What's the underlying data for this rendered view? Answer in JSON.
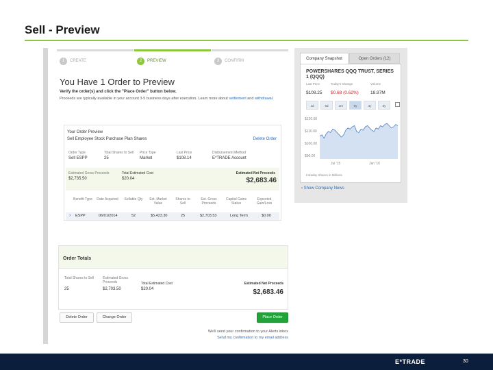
{
  "slide": {
    "title": "Sell - Preview",
    "page_number": "30",
    "logo_text": "E*TRADE",
    "logo_e": "E",
    "logo_star": "*",
    "logo_rest": "TRADE"
  },
  "stepper": [
    {
      "num": "1",
      "label": "CREATE",
      "active": false
    },
    {
      "num": "2",
      "label": "PREVIEW",
      "active": true
    },
    {
      "num": "3",
      "label": "CONFIRM",
      "active": false
    }
  ],
  "preview": {
    "heading": "You Have 1 Order to Preview",
    "verify": "Verify the order(s) and click the \"Place Order\" button below.",
    "proceeds_note": "Proceeds are typically available in your account 3-5 business days after execution. Learn more about",
    "link_settlement": "settlement",
    "and_text": "and",
    "link_withdrawal": "withdrawal."
  },
  "summary": {
    "title": "Your Order Preview",
    "subtitle": "Sell Employee Stock Purchase Plan Shares",
    "delete_link": "Delete Order",
    "fields": [
      {
        "label": "Order Type",
        "value": "Sell ESPP"
      },
      {
        "label": "Total Shares to Sell",
        "value": "25"
      },
      {
        "label": "Price Type",
        "value": "Market"
      },
      {
        "label": "Last Price",
        "value": "$108.14"
      },
      {
        "label": "Disbursement Method",
        "value": "E*TRADE Account"
      }
    ],
    "gross_label": "Estimated Gross Proceeds",
    "gross_value": "$2,735.50",
    "cost_label": "Total Estimated Cost",
    "cost_value": "$20.04",
    "net_label": "Estimated Net Proceeds",
    "net_value": "$2,683.46",
    "columns": [
      "Benefit Type",
      "Date Acquired",
      "Sellable Qty",
      "Est. Market Value",
      "Shares to Sell",
      "Est. Gross Proceeds",
      "Capital Gains Status",
      "Expected Gain/Loss"
    ],
    "row": [
      "ESPP",
      "06/01/2014",
      "52",
      "$5,423.30",
      "25",
      "$2,703.53",
      "Long Term",
      "$0.00"
    ]
  },
  "totals": {
    "title": "Order Totals",
    "total_shares_label": "Total Shares to Sell",
    "total_shares_value": "25",
    "gross_label": "Estimated Gross Proceeds",
    "gross_value": "$2,703.50",
    "cost_label": "Total Estimated Cost",
    "cost_value": "$20.04",
    "net_label": "Estimated Net Proceeds",
    "net_value": "$2,683.46"
  },
  "actions": {
    "delete": "Delete Order",
    "change": "Change Order",
    "place": "Place Order",
    "confirm_note": "We'll send your confirmation to your Alerts inbox",
    "email_link": "Send my confirmation to my email address"
  },
  "side": {
    "tab_snapshot": "Company Snapshot",
    "tab_open_orders": "Open Orders (12)",
    "company": "POWERSHARES QQQ TRUST, SERIES 1 (QQQ)",
    "quote_labels": [
      "Last Price",
      "Today's Change",
      "Volume"
    ],
    "quote_values": [
      "$108.25",
      "$0.68 (0.62%)",
      "18.97M"
    ],
    "ranges": [
      "1d",
      "5d",
      "3m",
      "6y",
      "3y",
      "5y"
    ],
    "selected_range": "6y",
    "y_ticks": [
      "$120.00",
      "$110.00",
      "$100.00",
      "$90.00"
    ],
    "x_ticks": [
      "Jul '15",
      "Jan '16"
    ],
    "legend": "Intraday Shares in Millions",
    "show_news": "Show Company News",
    "colors": {
      "line": "#4a7ebf",
      "area": "#d4e1f2"
    }
  },
  "chart_data": {
    "type": "area",
    "x_ticks": [
      "Jul '15",
      "Jan '16"
    ],
    "ylim": [
      88,
      125
    ],
    "values": [
      108,
      109,
      106,
      110,
      112,
      111,
      114,
      113,
      111,
      109,
      107,
      109,
      113,
      115,
      114,
      116,
      117,
      112,
      111,
      114,
      113,
      116,
      117,
      115,
      113,
      112,
      115,
      114,
      117,
      116,
      118,
      119,
      117,
      115,
      116,
      118,
      117
    ]
  }
}
